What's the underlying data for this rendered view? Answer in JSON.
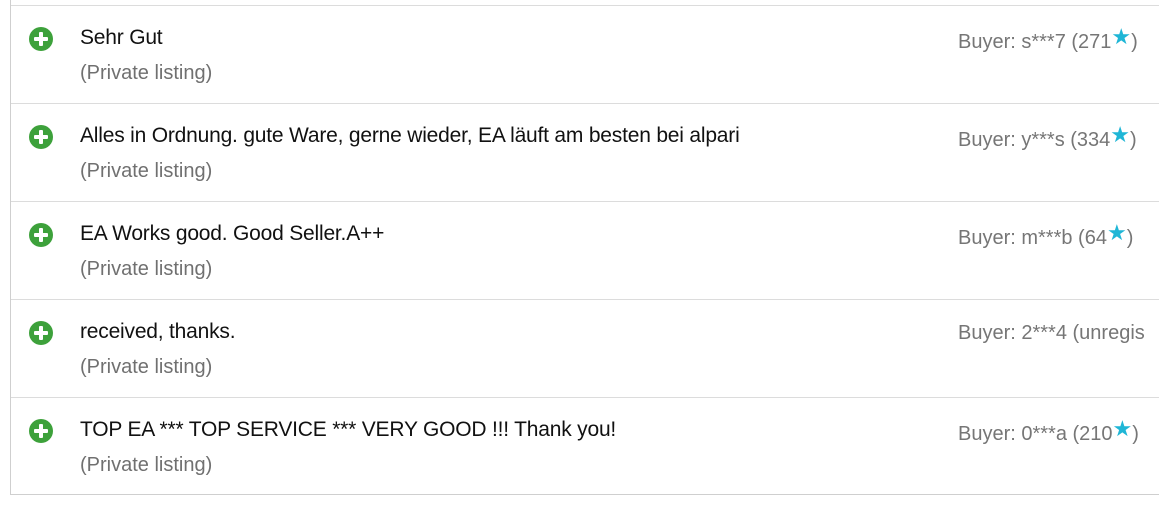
{
  "feedback": {
    "rows": [
      {
        "comment": "Sehr Gut",
        "listing": "(Private listing)",
        "buyer_prefix": "Buyer: s***7 (271",
        "buyer_suffix": ")",
        "has_star": true,
        "rating": "positive"
      },
      {
        "comment": "Alles in Ordnung. gute Ware, gerne wieder, EA läuft am besten bei alpari",
        "listing": "(Private listing)",
        "buyer_prefix": "Buyer: y***s (334",
        "buyer_suffix": ")",
        "has_star": true,
        "rating": "positive"
      },
      {
        "comment": "EA Works good. Good Seller.A++",
        "listing": "(Private listing)",
        "buyer_prefix": "Buyer: m***b (64",
        "buyer_suffix": ")",
        "has_star": true,
        "rating": "positive"
      },
      {
        "comment": "received, thanks.",
        "listing": "(Private listing)",
        "buyer_prefix": "Buyer: 2***4 (unregis",
        "buyer_suffix": "",
        "has_star": false,
        "rating": "positive"
      },
      {
        "comment": "TOP EA *** TOP SERVICE *** VERY GOOD !!! Thank you!",
        "listing": "(Private listing)",
        "buyer_prefix": "Buyer: 0***a (210",
        "buyer_suffix": ")",
        "has_star": true,
        "rating": "positive"
      }
    ]
  },
  "icons": {
    "positive": "positive-feedback-icon",
    "star": "star-icon"
  },
  "colors": {
    "positive": "#3da13b",
    "star": "#1fb6d6",
    "muted_text": "#707070",
    "divider": "#dcdcdc"
  },
  "glyphs": {
    "star": "★"
  }
}
